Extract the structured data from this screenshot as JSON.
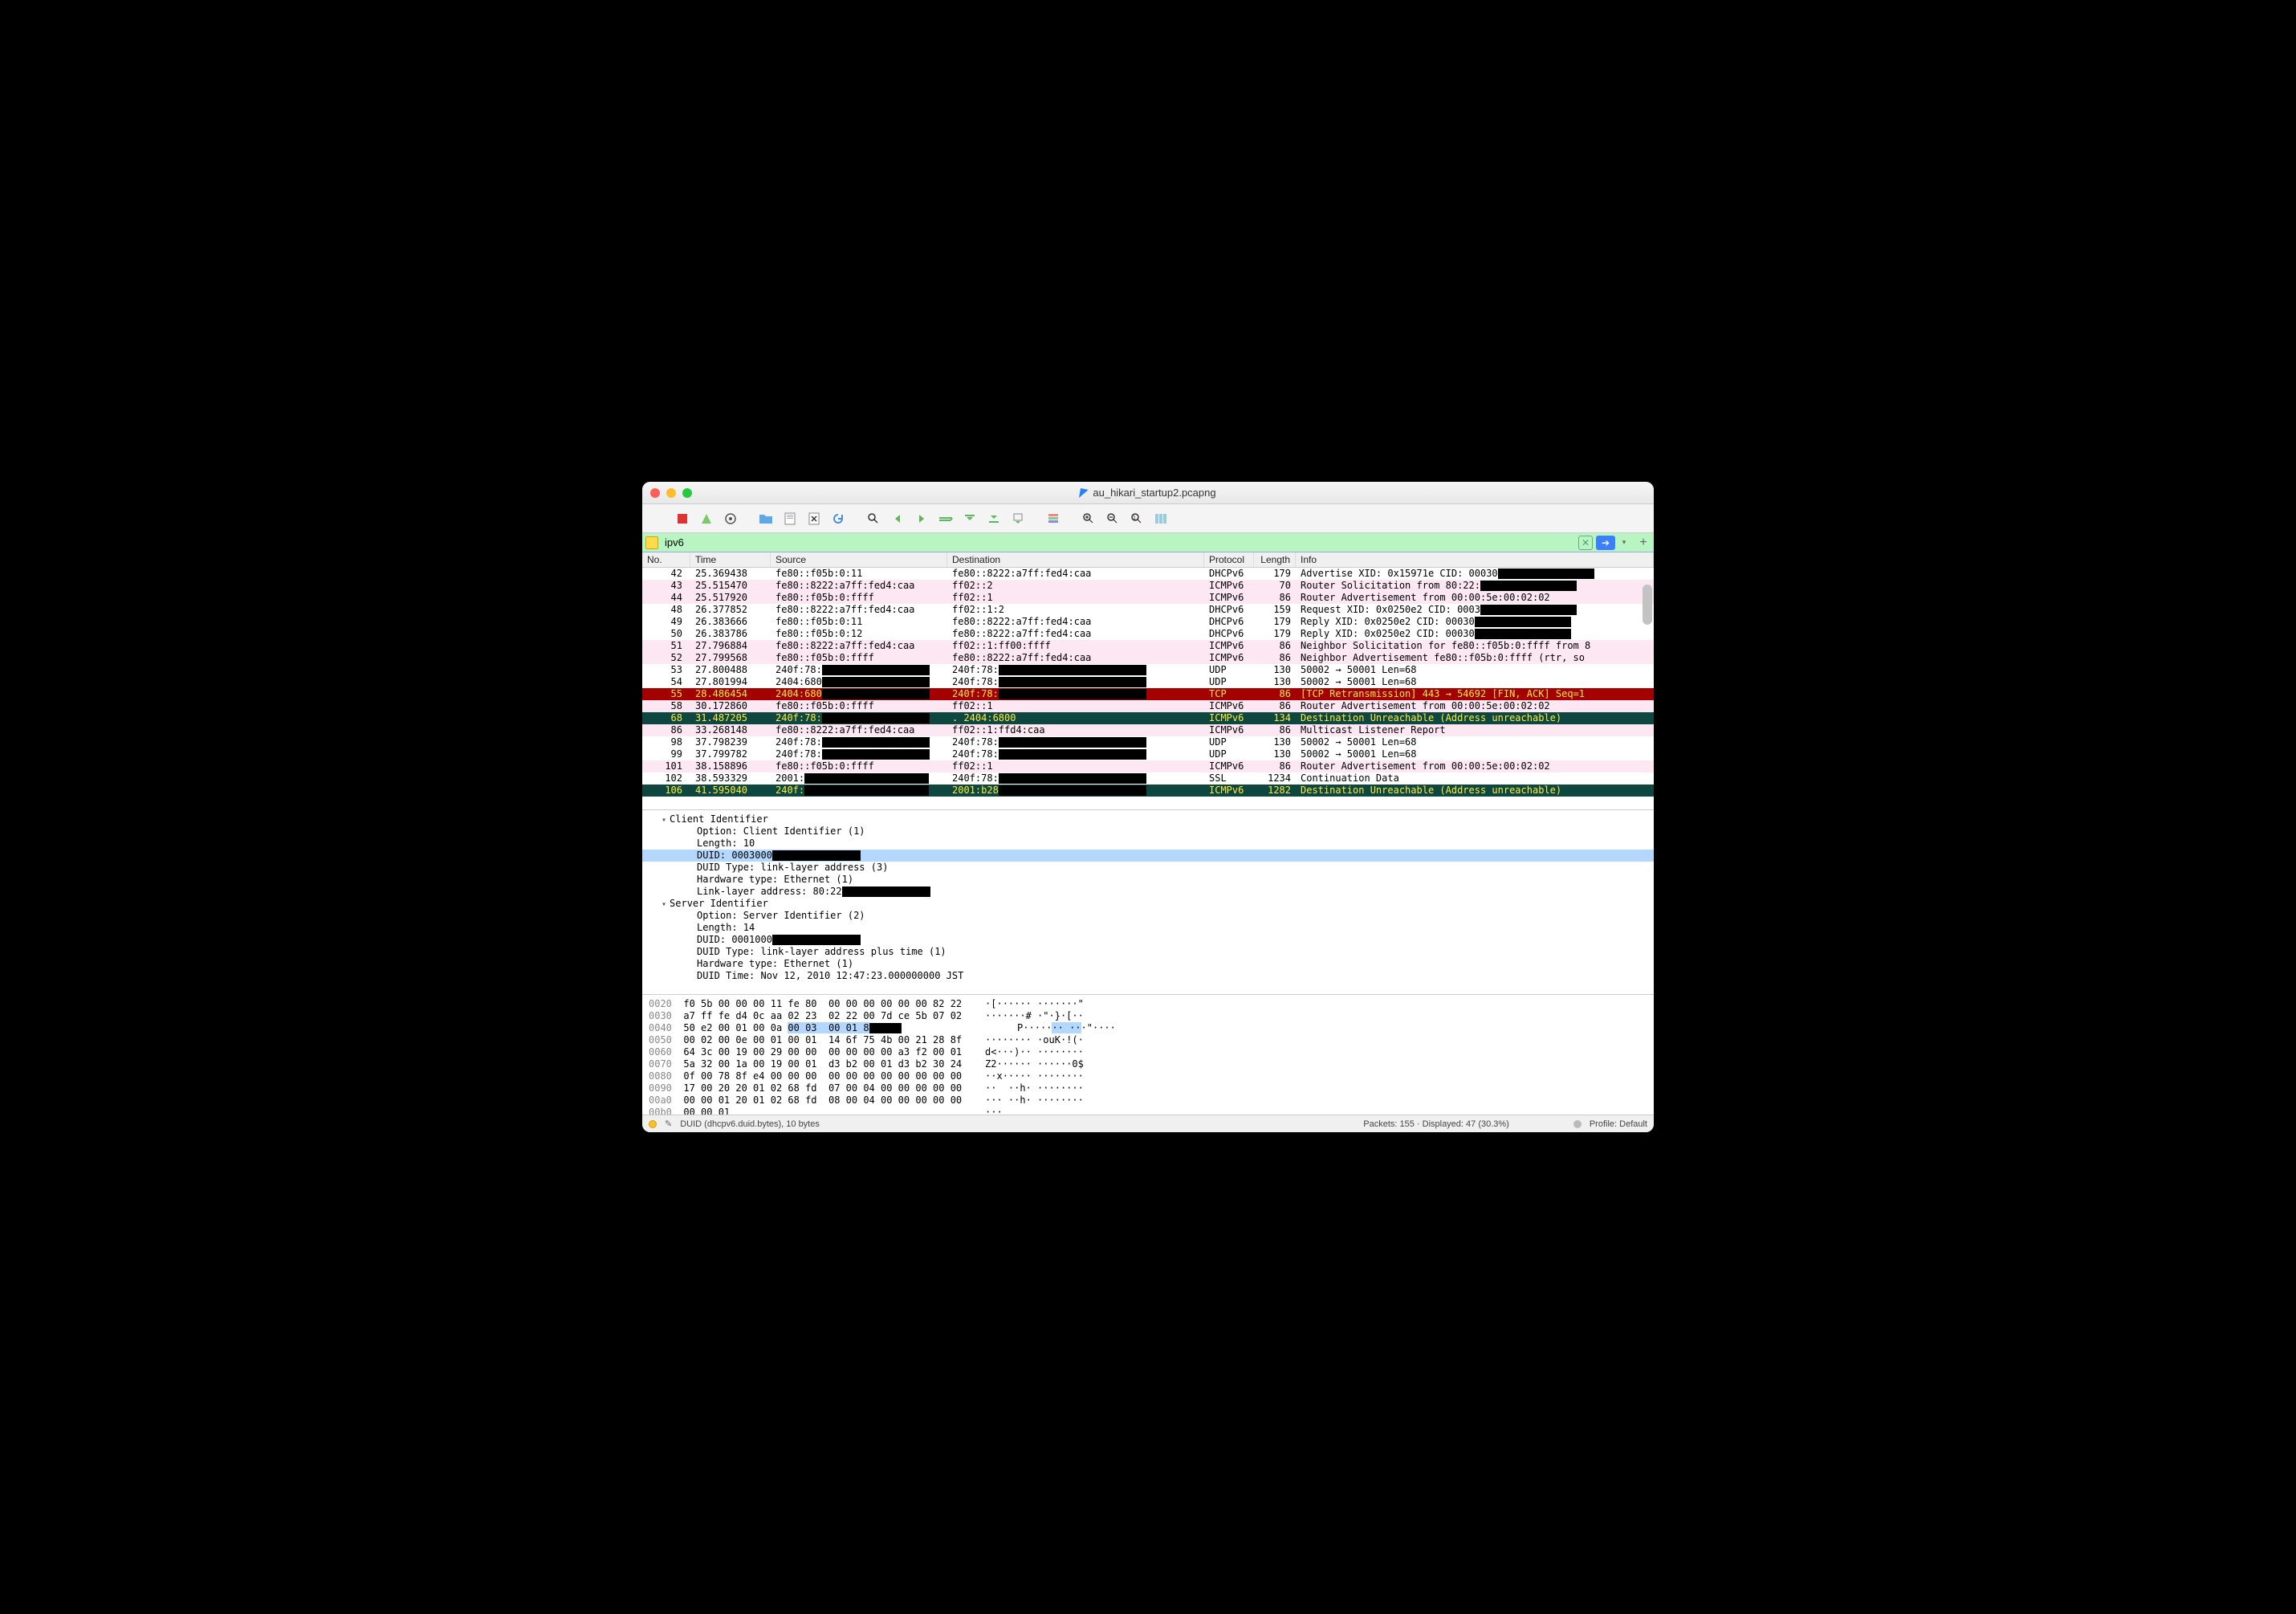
{
  "window": {
    "title": "au_hikari_startup2.pcapng"
  },
  "filter": {
    "value": "ipv6"
  },
  "columns": {
    "no": "No.",
    "time": "Time",
    "source": "Source",
    "destination": "Destination",
    "protocol": "Protocol",
    "length": "Length",
    "info": "Info"
  },
  "packets": [
    {
      "no": "42",
      "time": "25.369438",
      "src": "fe80::f05b:0:11",
      "dst": "fe80::8222:a7ff:fed4:caa",
      "proto": "DHCPv6",
      "len": "179",
      "info": "Advertise XID: 0x15971e CID: 00030",
      "bg": "white",
      "redact_info": true
    },
    {
      "no": "43",
      "time": "25.515470",
      "src": "fe80::8222:a7ff:fed4:caa",
      "dst": "ff02::2",
      "proto": "ICMPv6",
      "len": "70",
      "info": "Router Solicitation from 80:22:",
      "bg": "pink",
      "redact_info": true
    },
    {
      "no": "44",
      "time": "25.517920",
      "src": "fe80::f05b:0:ffff",
      "dst": "ff02::1",
      "proto": "ICMPv6",
      "len": "86",
      "info": "Router Advertisement from 00:00:5e:00:02:02",
      "bg": "pink"
    },
    {
      "no": "48",
      "time": "26.377852",
      "src": "fe80::8222:a7ff:fed4:caa",
      "dst": "ff02::1:2",
      "proto": "DHCPv6",
      "len": "159",
      "info": "Request XID: 0x0250e2 CID: 0003",
      "bg": "white",
      "redact_info": true
    },
    {
      "no": "49",
      "time": "26.383666",
      "src": "fe80::f05b:0:11",
      "dst": "fe80::8222:a7ff:fed4:caa",
      "proto": "DHCPv6",
      "len": "179",
      "info": "Reply XID: 0x0250e2 CID: 00030",
      "bg": "white",
      "redact_info": true
    },
    {
      "no": "50",
      "time": "26.383786",
      "src": "fe80::f05b:0:12",
      "dst": "fe80::8222:a7ff:fed4:caa",
      "proto": "DHCPv6",
      "len": "179",
      "info": "Reply XID: 0x0250e2 CID: 00030",
      "bg": "white",
      "redact_info": true
    },
    {
      "no": "51",
      "time": "27.796884",
      "src": "fe80::8222:a7ff:fed4:caa",
      "dst": "ff02::1:ff00:ffff",
      "proto": "ICMPv6",
      "len": "86",
      "info": "Neighbor Solicitation for fe80::f05b:0:ffff from 8",
      "bg": "pink"
    },
    {
      "no": "52",
      "time": "27.799568",
      "src": "fe80::f05b:0:ffff",
      "dst": "fe80::8222:a7ff:fed4:caa",
      "proto": "ICMPv6",
      "len": "86",
      "info": "Neighbor Advertisement fe80::f05b:0:ffff (rtr, so",
      "bg": "pink"
    },
    {
      "no": "53",
      "time": "27.800488",
      "src": "240f:78:",
      "dst": "240f:78:",
      "proto": "UDP",
      "len": "130",
      "info": "50002 → 50001 Len=68",
      "bg": "white",
      "redact_src": true,
      "redact_dst": true
    },
    {
      "no": "54",
      "time": "27.801994",
      "src": "2404:680",
      "dst": "240f:78:",
      "proto": "UDP",
      "len": "130",
      "info": "50002 → 50001 Len=68",
      "bg": "white",
      "redact_src": true,
      "redact_dst": true
    },
    {
      "no": "55",
      "time": "28.486454",
      "src": "2404:680",
      "dst": "240f:78:",
      "proto": "TCP",
      "len": "86",
      "info": "[TCP Retransmission] 443 → 54692 [FIN, ACK] Seq=1",
      "bg": "red",
      "redact_src": true,
      "redact_dst": true
    },
    {
      "no": "58",
      "time": "30.172860",
      "src": "fe80::f05b:0:ffff",
      "dst": "ff02::1",
      "proto": "ICMPv6",
      "len": "86",
      "info": "Router Advertisement from 00:00:5e:00:02:02",
      "bg": "pink"
    },
    {
      "no": "68",
      "time": "31.487205",
      "src": "240f:78:",
      "dst": "2404:6800",
      "proto": "ICMPv6",
      "len": "134",
      "info": "Destination Unreachable (Address unreachable)",
      "bg": "teal",
      "redact_src": true,
      "dot_dst": true
    },
    {
      "no": "86",
      "time": "33.268148",
      "src": "fe80::8222:a7ff:fed4:caa",
      "dst": "ff02::1:ffd4:caa",
      "proto": "ICMPv6",
      "len": "86",
      "info": "Multicast Listener Report",
      "bg": "pink"
    },
    {
      "no": "98",
      "time": "37.798239",
      "src": "240f:78:",
      "dst": "240f:78:",
      "proto": "UDP",
      "len": "130",
      "info": "50002 → 50001 Len=68",
      "bg": "white",
      "redact_src": true,
      "redact_dst": true
    },
    {
      "no": "99",
      "time": "37.799782",
      "src": "240f:78:",
      "dst": "240f:78:",
      "proto": "UDP",
      "len": "130",
      "info": "50002 → 50001 Len=68",
      "bg": "white",
      "redact_src": true,
      "redact_dst": true
    },
    {
      "no": "101",
      "time": "38.158896",
      "src": "fe80::f05b:0:ffff",
      "dst": "ff02::1",
      "proto": "ICMPv6",
      "len": "86",
      "info": "Router Advertisement from 00:00:5e:00:02:02",
      "bg": "pink"
    },
    {
      "no": "102",
      "time": "38.593329",
      "src": "2001:",
      "dst": "240f:78:",
      "proto": "SSL",
      "len": "1234",
      "info": "Continuation Data",
      "bg": "white",
      "redact_src": true,
      "redact_dst": true
    },
    {
      "no": "106",
      "time": "41.595040",
      "src": "240f:",
      "dst": "2001:b28",
      "proto": "ICMPv6",
      "len": "1282",
      "info": "Destination Unreachable (Address unreachable)",
      "bg": "teal",
      "redact_src": true,
      "redact_dst": true
    }
  ],
  "details": [
    {
      "lvl": 0,
      "text": "Client Identifier",
      "disc": true
    },
    {
      "lvl": 2,
      "text": "Option: Client Identifier (1)"
    },
    {
      "lvl": 2,
      "text": "Length: 10"
    },
    {
      "lvl": 2,
      "text": "DUID: 0003000",
      "sel": true,
      "redact": true
    },
    {
      "lvl": 2,
      "text": "DUID Type: link-layer address (3)"
    },
    {
      "lvl": 2,
      "text": "Hardware type: Ethernet (1)"
    },
    {
      "lvl": 2,
      "text": "Link-layer address: 80:22",
      "redact": true
    },
    {
      "lvl": 0,
      "text": "Server Identifier",
      "disc": true
    },
    {
      "lvl": 2,
      "text": "Option: Server Identifier (2)"
    },
    {
      "lvl": 2,
      "text": "Length: 14"
    },
    {
      "lvl": 2,
      "text": "DUID: 0001000",
      "redact": true
    },
    {
      "lvl": 2,
      "text": "DUID Type: link-layer address plus time (1)"
    },
    {
      "lvl": 2,
      "text": "Hardware type: Ethernet (1)"
    },
    {
      "lvl": 2,
      "text": "DUID Time: Nov 12, 2010 12:47:23.000000000 JST"
    }
  ],
  "hex": [
    {
      "addr": "0020",
      "bytes": "f0 5b 00 00 00 11 fe 80  00 00 00 00 00 00 82 22",
      "ascii": "·[······ ·······\""
    },
    {
      "addr": "0030",
      "bytes": "a7 ff fe d4 0c aa 02 23  02 22 00 7d ce 5b 07 02",
      "ascii": "·······# ·\"·}·[··"
    },
    {
      "addr": "0040",
      "bytes": "50 e2 00 01 00 0a ",
      "sel": "00 03  00 01 8",
      "red": true,
      "ascii": "P·····__ __·\"····",
      "selstart": "·· ··"
    },
    {
      "addr": "0050",
      "bytes": "00 02 00 0e 00 01 00 01  14 6f 75 4b 00 21 28 8f",
      "ascii": "········ ·ouK·!(·"
    },
    {
      "addr": "0060",
      "bytes": "64 3c 00 19 00 29 00 00  00 00 00 00 a3 f2 00 01",
      "ascii": "d<···)·· ········"
    },
    {
      "addr": "0070",
      "bytes": "5a 32 00 1a 00 19 00 01  d3 b2 00 01 d3 b2 30 24",
      "ascii": "Z2······ ······0$"
    },
    {
      "addr": "0080",
      "bytes": "0f 00 78 8f e4 00 00 00  00 00 00 00 00 00 00 00",
      "ascii": "··x····· ········"
    },
    {
      "addr": "0090",
      "bytes": "17 00 20 20 01 02 68 fd  07 00 04 00 00 00 00 00",
      "ascii": "··  ··h· ········"
    },
    {
      "addr": "00a0",
      "bytes": "00 00 01 20 01 02 68 fd  08 00 04 00 00 00 00 00",
      "ascii": "··· ··h· ········"
    },
    {
      "addr": "00b0",
      "bytes": "00 00 01",
      "ascii": "···"
    }
  ],
  "status": {
    "field": "DUID (dhcpv6.duid.bytes), 10 bytes",
    "packets": "Packets: 155 · Displayed: 47 (30.3%)",
    "profile": "Profile: Default"
  }
}
